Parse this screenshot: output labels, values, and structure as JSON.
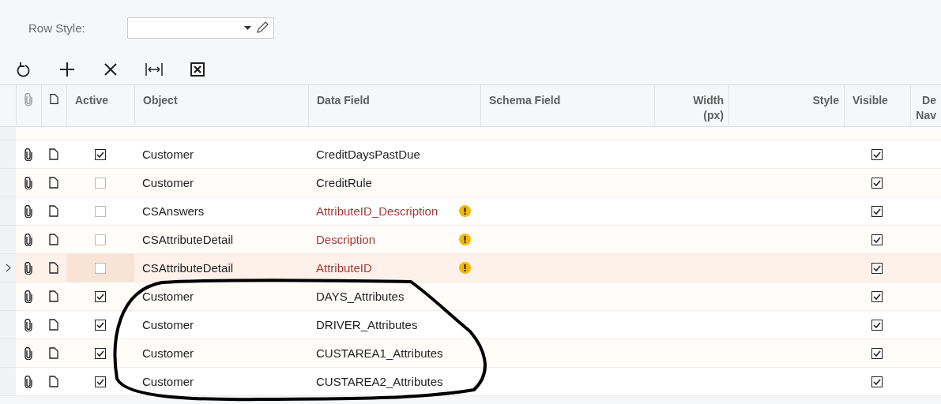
{
  "row_style": {
    "label": "Row Style:"
  },
  "toolbar": [
    {
      "kind": "refresh"
    },
    {
      "kind": "add"
    },
    {
      "kind": "delete"
    },
    {
      "kind": "fit"
    },
    {
      "kind": "excel"
    }
  ],
  "table": {
    "columns": [
      "Active",
      "Object",
      "Data Field",
      "Schema Field",
      "Width (px)",
      "Style",
      "Visible",
      "De Nav"
    ],
    "rows": [
      {
        "selected": false,
        "active": true,
        "object": "Customer",
        "data_field": "CreditDaysPastDue",
        "warning": false,
        "visible": true
      },
      {
        "selected": false,
        "active": false,
        "object": "Customer",
        "data_field": "CreditRule",
        "warning": false,
        "visible": true
      },
      {
        "selected": false,
        "active": false,
        "object": "CSAnswers",
        "data_field": "AttributeID_Description",
        "warning": true,
        "visible": true
      },
      {
        "selected": false,
        "active": false,
        "object": "CSAttributeDetail",
        "data_field": "Description",
        "warning": true,
        "visible": true
      },
      {
        "selected": true,
        "active": false,
        "object": "CSAttributeDetail",
        "data_field": "AttributeID",
        "warning": true,
        "visible": true
      },
      {
        "selected": false,
        "active": true,
        "object": "Customer",
        "data_field": "DAYS_Attributes",
        "warning": false,
        "visible": true
      },
      {
        "selected": false,
        "active": true,
        "object": "Customer",
        "data_field": "DRIVER_Attributes",
        "warning": false,
        "visible": true
      },
      {
        "selected": false,
        "active": true,
        "object": "Customer",
        "data_field": "CUSTAREA1_Attributes",
        "warning": false,
        "visible": true
      },
      {
        "selected": false,
        "active": true,
        "object": "Customer",
        "data_field": "CUSTAREA2_Attributes",
        "warning": false,
        "visible": true
      }
    ]
  },
  "annotation": {
    "kind": "loop"
  }
}
